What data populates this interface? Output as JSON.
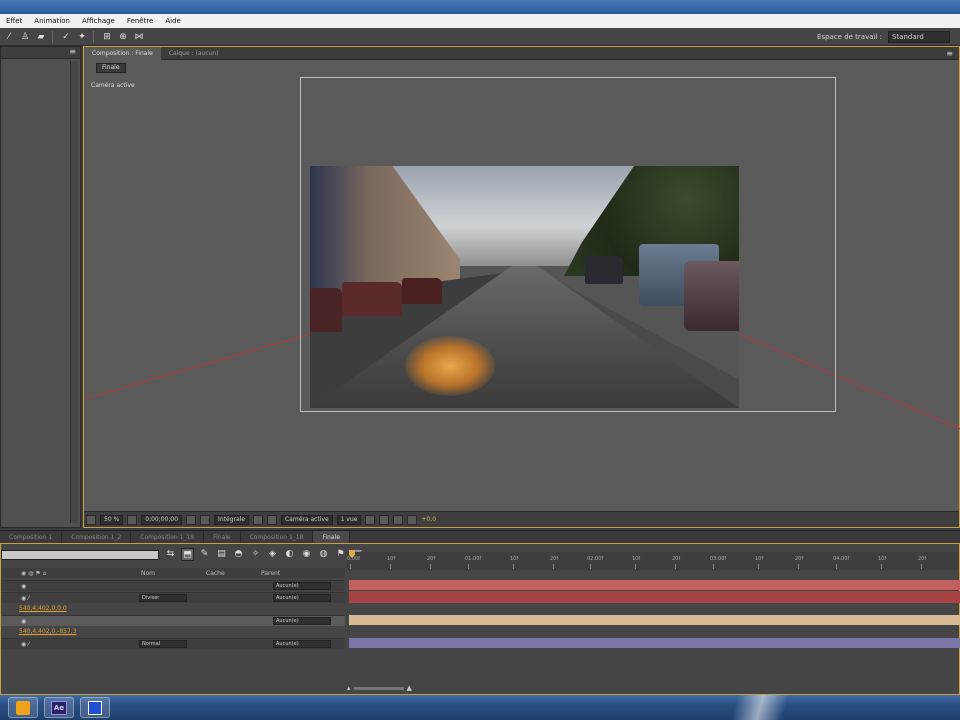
{
  "menubar": {
    "items": [
      "Effet",
      "Animation",
      "Affichage",
      "Fenêtre",
      "Aide"
    ]
  },
  "workspace": {
    "label": "Espace de travail :",
    "value": "Standard"
  },
  "composition": {
    "tabs": [
      "Composition : Finale",
      "Calque : (aucun)"
    ],
    "flowchart_button": "Finale",
    "camera_label": "Caméra active",
    "zoom": "50 %",
    "time": "0;00;00;00",
    "resolution": "Intégrale",
    "view": "Caméra active",
    "view_count": "1 vue",
    "exposure": "+0,0"
  },
  "timeline": {
    "tabs": [
      "Composition 1",
      "Composition 1_2",
      "Composition 1_18",
      "Finale",
      "Composition 1_18",
      "Finale"
    ],
    "columns": [
      "Nom",
      "Cache",
      "Parent"
    ],
    "layers": [
      {
        "mode": "",
        "parent": "Aucun(e)"
      },
      {
        "mode": "Diviser",
        "parent": "Aucun(e)"
      },
      {
        "mode": "",
        "parent": "Aucun(e)"
      },
      {
        "mode": "Normal",
        "parent": "Aucun(e)"
      }
    ],
    "properties": [
      "540,4,402,0,0,0",
      "540,4,402,0,-857,3"
    ],
    "ruler": [
      "0:00f",
      "10f",
      "20f",
      "01:00f",
      "10f",
      "20f",
      "02:00f",
      "10f",
      "20f",
      "03:00f",
      "10f",
      "20f",
      "04:00f",
      "10f",
      "20f"
    ],
    "track_colors": [
      "#a84343",
      "#a84343",
      "#d6b894",
      "#7b76a8"
    ]
  },
  "taskbar": {
    "items": [
      "media-player",
      "after-effects",
      "program"
    ],
    "ae_label": "Ae"
  }
}
